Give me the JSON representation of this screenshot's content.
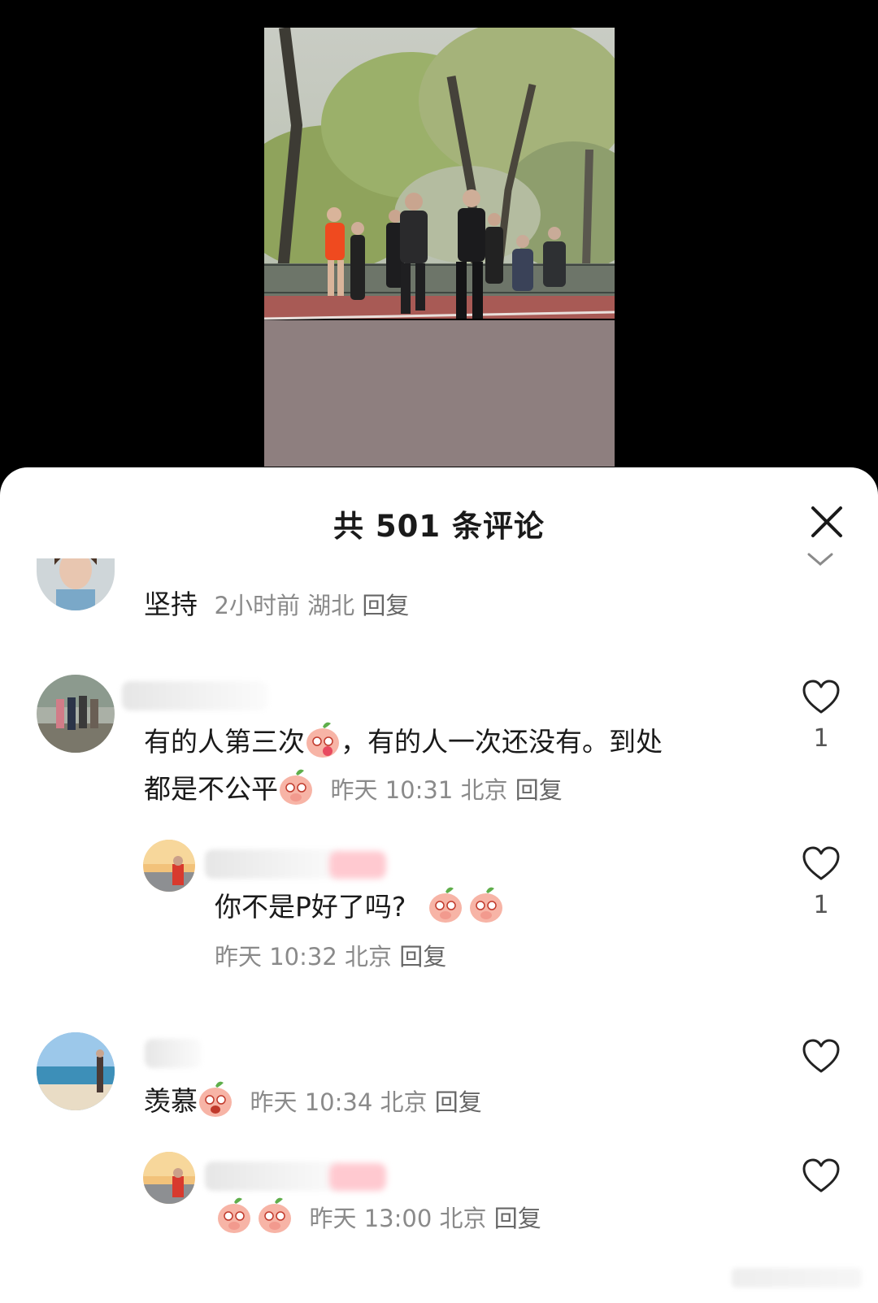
{
  "header": {
    "title": "共 501 条评论"
  },
  "icons": {
    "close": "close-icon",
    "like": "heart-outline-icon",
    "expand": "chevron-down-icon"
  },
  "comments": [
    {
      "text": "坚持",
      "time": "2小时前",
      "location": "湖北",
      "reply_label": "回复"
    },
    {
      "text_line1": "有的人第三次",
      "text_line1b": "，有的人一次还没有。到处",
      "text_line2": "都是不公平",
      "time": "昨天 10:31",
      "location": "北京",
      "reply_label": "回复",
      "likes": "1",
      "replies": [
        {
          "text": "你不是P好了吗?",
          "time": "昨天 10:32",
          "location": "北京",
          "reply_label": "回复",
          "likes": "1"
        }
      ]
    },
    {
      "text": "羡慕",
      "time": "昨天 10:34",
      "location": "北京",
      "reply_label": "回复",
      "replies": [
        {
          "text": "",
          "time": "昨天 13:00",
          "location": "北京",
          "reply_label": "回复"
        }
      ]
    }
  ],
  "colors": {
    "sheet": "#ffffff",
    "backdrop": "#000000",
    "meta": "#8a8a8a"
  }
}
